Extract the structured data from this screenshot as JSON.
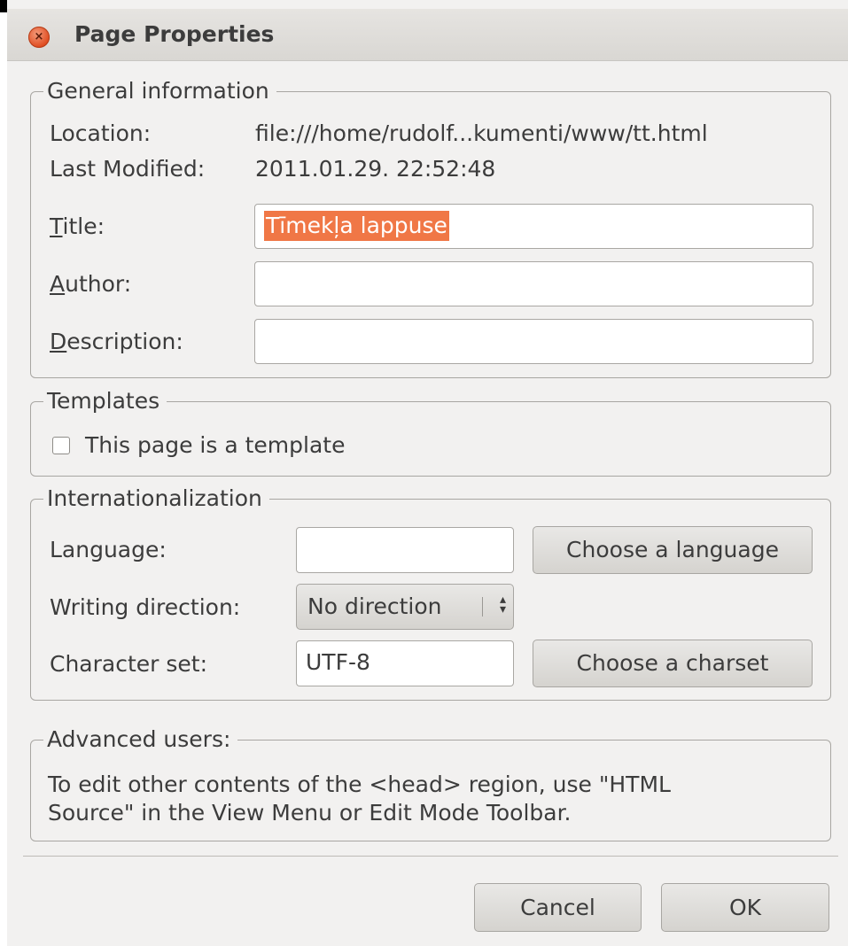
{
  "window": {
    "title": "Page Properties",
    "close_glyph": "×"
  },
  "general": {
    "legend": "General information",
    "location_label": "Location:",
    "location_value": "file:///home/rudolf...kumenti/www/tt.html",
    "modified_label": "Last Modified:",
    "modified_value": "2011.01.29. 22:52:48",
    "title_label_mnemonic": "T",
    "title_label_rest": "itle:",
    "title_value": "Tīmekļa lappuse",
    "author_label_mnemonic": "A",
    "author_label_rest": "uthor:",
    "author_value": "",
    "description_label_mnemonic": "D",
    "description_label_rest": "escription:",
    "description_value": ""
  },
  "templates": {
    "legend": "Templates",
    "checkbox_label": "This page is a template",
    "checked": false
  },
  "i18n": {
    "legend": "Internationalization",
    "language_label": "Language:",
    "language_value": "",
    "choose_language": "Choose a language",
    "direction_label": "Writing direction:",
    "direction_value": "No direction",
    "charset_label": "Character set:",
    "charset_value": "UTF-8",
    "choose_charset": "Choose a charset"
  },
  "advanced": {
    "legend": "Advanced users:",
    "line1": "To edit other contents of the <head> region, use \"HTML",
    "line2": "Source\" in the View Menu or Edit Mode Toolbar."
  },
  "buttons": {
    "cancel": "Cancel",
    "ok": "OK"
  },
  "colors": {
    "selection": "#f07746",
    "close_button": "#df4b1f",
    "dialog_bg": "#f2f1f0"
  }
}
